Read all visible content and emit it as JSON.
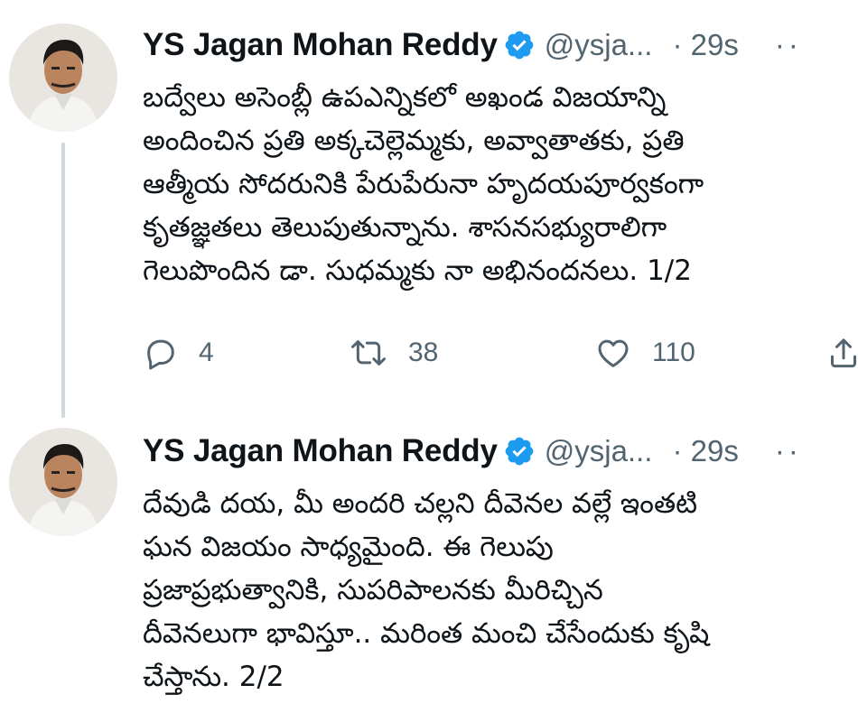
{
  "thread": {
    "tweets": [
      {
        "author_name": "YS Jagan Mohan Reddy",
        "handle": "@ysja...",
        "time": "· 29s",
        "more": "··",
        "lines": [
          "బద్వేలు అసెంబ్లీ ఉపఎన్నికలో అఖండ విజయాన్ని",
          "అందించిన ప్రతి అక్కచెల్లెమ్మకు, అవ్వాతాతకు, ప్రతి",
          "ఆత్మీయ సోదరునికి పేరుపేరునా హృదయపూర్వకంగా",
          "కృతజ్ఞతలు తెలుపుతున్నాను. శాసనసభ్యురాలిగా",
          "గెలుపొందిన డా. సుధమ్మకు నా అభినందనలు. 1/2"
        ],
        "reply_count": "4",
        "retweet_count": "38",
        "like_count": "110"
      },
      {
        "author_name": "YS Jagan Mohan Reddy",
        "handle": "@ysja...",
        "time": "· 29s",
        "more": "··",
        "lines": [
          "దేవుడి దయ, మీ అందరి చల్లని దీవెనల వల్లే ఇంతటి",
          "ఘన విజయం సాధ్యమైంది. ఈ గెలుపు",
          "ప్రజాప్రభుత్వానికి, సుపరిపాలనకు మీరిచ్చిన",
          "దీవెనలుగా భావిస్తూ.. మరింత మంచి చేసేందుకు కృషి",
          "చేస్తాను. 2/2"
        ]
      }
    ]
  },
  "colors": {
    "text": "#0f1419",
    "secondary": "#536471",
    "verified": "#1d9bf0",
    "thread_line": "#cfd9de"
  },
  "icons": {
    "reply": "reply-icon",
    "retweet": "retweet-icon",
    "like": "like-icon",
    "share": "share-icon",
    "verified": "verified-badge-icon"
  }
}
